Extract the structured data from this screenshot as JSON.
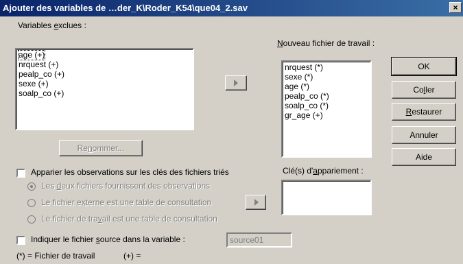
{
  "window": {
    "title": "Ajouter des variables de …der_K\\Roder_K54\\que04_2.sav",
    "close_glyph": "×"
  },
  "excluded": {
    "label_pre": "Variables ",
    "label_ul": "e",
    "label_post": "xclues :",
    "items": [
      "age (+)",
      "nrquest (+)",
      "pealp_co (+)",
      "sexe (+)",
      "soalp_co (+)"
    ]
  },
  "new_file": {
    "label_ul": "N",
    "label_post": "ouveau fichier de travail :",
    "items": [
      "nrquest (*)",
      "sexe (*)",
      "age (*)",
      "pealp_co (*)",
      "soalp_co (*)",
      "gr_age (+)"
    ]
  },
  "keys": {
    "label_pre": "Clé(s) d'",
    "label_ul": "a",
    "label_post": "ppariement :"
  },
  "buttons": {
    "ok": "OK",
    "paste_pre": "Co",
    "paste_ul": "l",
    "paste_post": "ler",
    "reset_ul": "R",
    "reset_post": "estaurer",
    "cancel": "Annuler",
    "help": "Aide",
    "rename_pre": "Re",
    "rename_ul": "n",
    "rename_post": "ommer..."
  },
  "match": {
    "label": "Apparier les observations sur les clés des fichiers triés",
    "checked": false,
    "options": [
      {
        "pre": "Les ",
        "ul": "d",
        "post": "eux fichiers fournissent des observations",
        "selected": true
      },
      {
        "pre": "Le fichier e",
        "ul": "x",
        "post": "terne est une table de consultation",
        "selected": false
      },
      {
        "pre": "Le fichier de tra",
        "ul": "v",
        "post": "ail est une table de consultation",
        "selected": false
      }
    ]
  },
  "source": {
    "label_pre": "Indiquer le fichier ",
    "label_ul": "s",
    "label_post": "ource dans la variable :",
    "value": "source01",
    "checked": false
  },
  "legend": {
    "star": "(*) = Fichier de travail",
    "plus": "(+) ="
  }
}
